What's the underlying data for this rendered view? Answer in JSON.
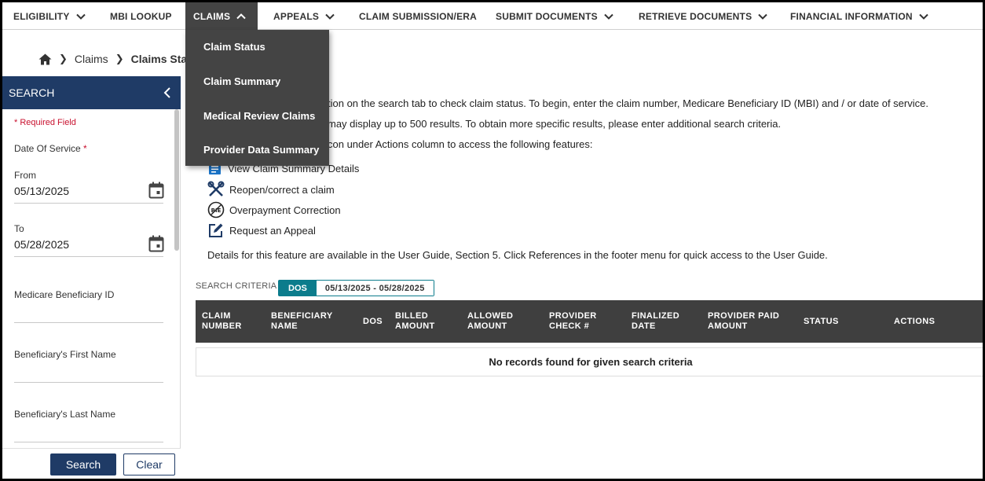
{
  "nav": {
    "eligibility": "ELIGIBILITY",
    "mbi_lookup": "MBI LOOKUP",
    "claims": "CLAIMS",
    "appeals": "APPEALS",
    "claim_submission": "CLAIM SUBMISSION/ERA",
    "submit_documents": "SUBMIT DOCUMENTS",
    "retrieve_documents": "RETRIEVE DOCUMENTS",
    "financial_information": "FINANCIAL INFORMATION"
  },
  "claims_menu": {
    "items": [
      "Claim Status",
      "Claim Summary",
      "Medical Review Claims",
      "Provider Data Summary"
    ]
  },
  "breadcrumb": {
    "home_icon": "home-icon",
    "parent": "Claims",
    "current": "Claims Status"
  },
  "sidebar": {
    "title": "SEARCH",
    "required_note": "* Required Field",
    "date_of_service_label": "Date Of Service",
    "required_star": "*",
    "from_label": "From",
    "from_value": "05/13/2025",
    "to_label": "To",
    "to_value": "05/28/2025",
    "mbi_label": "Medicare Beneficiary ID",
    "first_name_label": "Beneficiary's First Name",
    "last_name_label": "Beneficiary's Last Name",
    "search_button": "Search",
    "clear_button": "Clear"
  },
  "info": {
    "line1": "tion on the search tab to check claim status. To begin, enter the claim number, Medicare Beneficiary ID (MBI) and / or date of service.",
    "line2": "may display up to 500 results. To obtain more specific results, please enter additional search criteria.",
    "line3": "con under Actions column to access the following features:",
    "features": [
      {
        "icon": "document-icon",
        "label": "View Claim Summary Details"
      },
      {
        "icon": "tools-icon",
        "label": "Reopen/correct a claim"
      },
      {
        "icon": "overpayment-icon",
        "label": "Overpayment Correction"
      },
      {
        "icon": "edit-icon",
        "label": "Request an Appeal"
      }
    ],
    "details_note": "Details for this feature are available in the User Guide, Section 5. Click References in the footer menu for quick access to the User Guide."
  },
  "criteria": {
    "label": "SEARCH CRITERIA",
    "chip_key": "DOS",
    "chip_value": "05/13/2025 - 05/28/2025"
  },
  "table": {
    "columns": [
      [
        "CLAIM",
        "NUMBER"
      ],
      [
        "BENEFICIARY",
        "NAME"
      ],
      [
        "DOS"
      ],
      [
        "BILLED",
        "AMOUNT"
      ],
      [
        "ALLOWED",
        "AMOUNT"
      ],
      [
        "PROVIDER",
        "CHECK #"
      ],
      [
        "FINALIZED",
        "DATE"
      ],
      [
        "PROVIDER PAID",
        "AMOUNT"
      ],
      [
        "STATUS"
      ],
      [
        "ACTIONS"
      ]
    ],
    "empty_message": "No records found for given search criteria"
  },
  "colors": {
    "nav_active": "#444444",
    "sidebar_header": "#1f3b66",
    "chip_accent": "#0c7c8c",
    "required": "#c8102e",
    "table_header": "#3f3f3f"
  }
}
